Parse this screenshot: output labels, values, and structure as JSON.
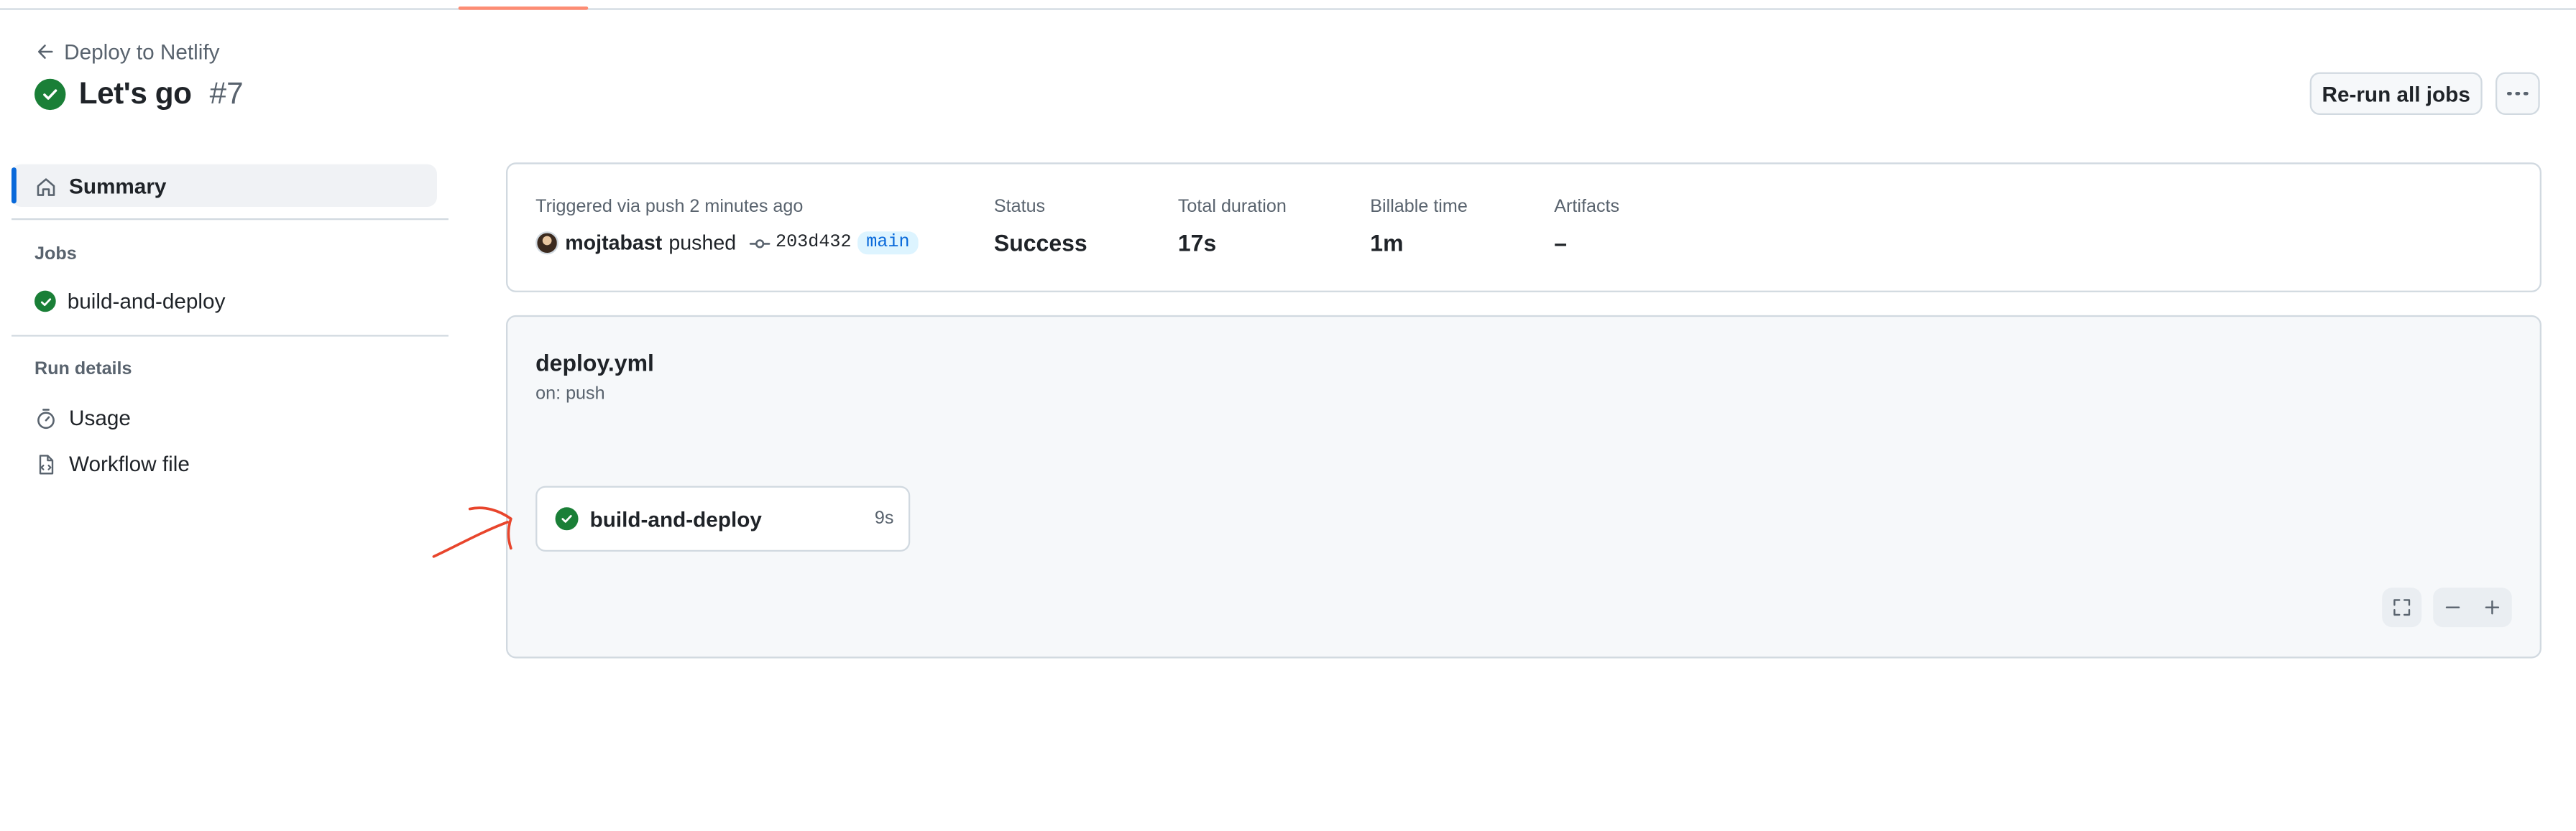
{
  "header": {
    "back_label": "Deploy to Netlify",
    "title": "Let's go",
    "run_number": "#7",
    "rerun_label": "Re-run all jobs"
  },
  "sidebar": {
    "summary_label": "Summary",
    "jobs_heading": "Jobs",
    "jobs": [
      {
        "label": "build-and-deploy",
        "status": "success"
      }
    ],
    "run_details_heading": "Run details",
    "details": [
      {
        "label": "Usage",
        "icon": "stopwatch-icon"
      },
      {
        "label": "Workflow file",
        "icon": "file-code-icon"
      }
    ]
  },
  "summary": {
    "trigger_text": "Triggered via push 2 minutes ago",
    "user": "mojtabast",
    "action": "pushed",
    "commit_sha": "203d432",
    "branch": "main",
    "status_label": "Status",
    "status_value": "Success",
    "duration_label": "Total duration",
    "duration_value": "17s",
    "billable_label": "Billable time",
    "billable_value": "1m",
    "artifacts_label": "Artifacts",
    "artifacts_value": "–"
  },
  "graph": {
    "workflow_file": "deploy.yml",
    "trigger": "on: push",
    "job": {
      "name": "build-and-deploy",
      "duration": "9s",
      "status": "success"
    }
  },
  "colors": {
    "success": "#1a7f37",
    "accent": "#0969da",
    "annotation": "#e8452c",
    "tab_underline": "#fd8c73"
  }
}
